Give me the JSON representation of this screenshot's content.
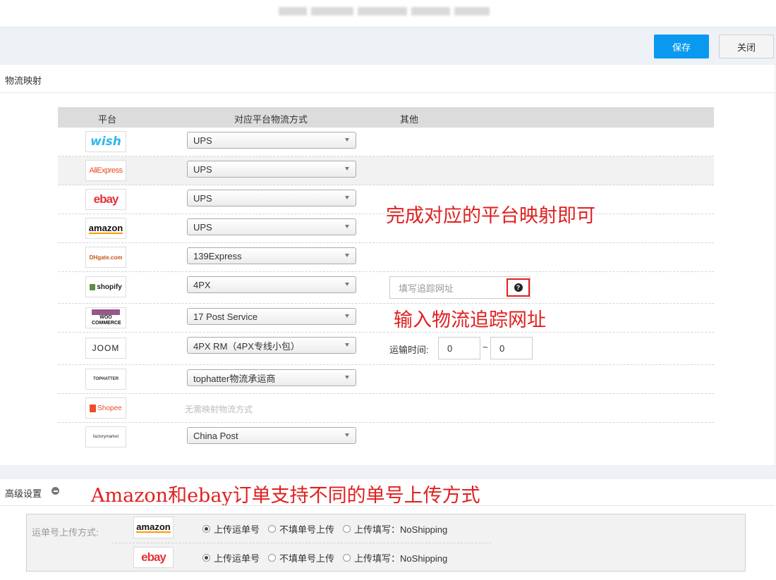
{
  "toolbar": {
    "save_label": "保存",
    "close_label": "关闭"
  },
  "mapping": {
    "section_title": "物流映射",
    "headers": {
      "platform": "平台",
      "method": "对应平台物流方式",
      "other": "其他"
    },
    "rows": [
      {
        "logo": "wish",
        "method": "UPS"
      },
      {
        "logo": "AliExpress",
        "method": "UPS"
      },
      {
        "logo": "ebay",
        "method": "UPS"
      },
      {
        "logo": "amazon",
        "method": "UPS"
      },
      {
        "logo": "DHgate.com",
        "method": "139Express"
      },
      {
        "logo": "shopify",
        "method": "4PX"
      },
      {
        "logo": "WOO COMMERCE",
        "method": "17 Post Service"
      },
      {
        "logo": "JOOM",
        "method": "4PX RM（4PX专线小包）"
      },
      {
        "logo": "TOPHATTER",
        "method": "tophatter物流承运商"
      },
      {
        "logo": "Shopee",
        "method": "无需映射物流方式"
      },
      {
        "logo": "factorymarket",
        "method": "China Post"
      }
    ],
    "tracking_placeholder": "填写追踪网址",
    "transit_label": "运输时间:",
    "transit_min": "0",
    "transit_max": "0",
    "tilde": "~"
  },
  "annotations": {
    "a1": "完成对应的平台映射即可",
    "a2": "输入物流追踪网址",
    "a3": "Amazon和ebay订单支持不同的单号上传方式"
  },
  "advanced": {
    "title": "高级设置",
    "upload_label": "运单号上传方式:",
    "amazon_logo": "amazon",
    "ebay_logo": "ebay",
    "options": [
      "上传运单号",
      "不填单号上传",
      "上传填写：NoShipping"
    ]
  },
  "colors": {
    "accent": "#0a99f0",
    "annotation": "#e02020"
  }
}
